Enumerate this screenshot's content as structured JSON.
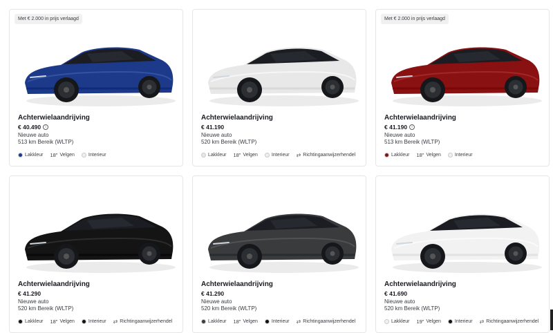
{
  "colors": {
    "blue": "#1d3a8a",
    "white": "#e8e8e8",
    "red": "#8a1111",
    "black": "#141414",
    "gray": "#3a3b3d",
    "silverwhite": "#f2f2f2"
  },
  "cards": [
    {
      "badge": "Met € 2.000 in prijs verlaagd",
      "title": "Achterwielaandrijving",
      "price": "€ 40.490",
      "condition": "Nieuwe auto",
      "range": "513 km Bereik (WLTP)",
      "paint_label": "Lakkleur",
      "wheels": "18\"",
      "wheels_label": "Velgen",
      "interior_label": "Interieur",
      "extra_label": "",
      "paint_color": "blue",
      "interior_color": "light"
    },
    {
      "badge": "",
      "title": "Achterwielaandrijving",
      "price": "€ 41.190",
      "condition": "Nieuwe auto",
      "range": "520 km Bereik (WLTP)",
      "paint_label": "Lakkleur",
      "wheels": "18\"",
      "wheels_label": "Velgen",
      "interior_label": "Interieur",
      "extra_label": "Richtingaanwijzerhendel",
      "paint_color": "white",
      "interior_color": "light"
    },
    {
      "badge": "Met € 2.000 in prijs verlaagd",
      "title": "Achterwielaandrijving",
      "price": "€ 41.190",
      "condition": "Nieuwe auto",
      "range": "513 km Bereik (WLTP)",
      "paint_label": "Lakkleur",
      "wheels": "18\"",
      "wheels_label": "Velgen",
      "interior_label": "Interieur",
      "extra_label": "",
      "paint_color": "red",
      "interior_color": "light"
    },
    {
      "badge": "",
      "title": "Achterwielaandrijving",
      "price": "€ 41.290",
      "condition": "Nieuwe auto",
      "range": "520 km Bereik (WLTP)",
      "paint_label": "Lakkleur",
      "wheels": "18\"",
      "wheels_label": "Velgen",
      "interior_label": "Interieur",
      "extra_label": "Richtingaanwijzerhendel",
      "paint_color": "black",
      "interior_color": "dark"
    },
    {
      "badge": "",
      "title": "Achterwielaandrijving",
      "price": "€ 41.290",
      "condition": "Nieuwe auto",
      "range": "520 km Bereik (WLTP)",
      "paint_label": "Lakkleur",
      "wheels": "18\"",
      "wheels_label": "Velgen",
      "interior_label": "Interieur",
      "extra_label": "Richtingaanwijzerhendel",
      "paint_color": "gray",
      "interior_color": "dark"
    },
    {
      "badge": "",
      "title": "Achterwielaandrijving",
      "price": "€ 41.690",
      "condition": "Nieuwe auto",
      "range": "520 km Bereik (WLTP)",
      "paint_label": "Lakkleur",
      "wheels": "19\"",
      "wheels_label": "Velgen",
      "interior_label": "Interieur",
      "extra_label": "Richtingaanwijzerhendel",
      "paint_color": "silverwhite",
      "interior_color": "dark"
    }
  ]
}
